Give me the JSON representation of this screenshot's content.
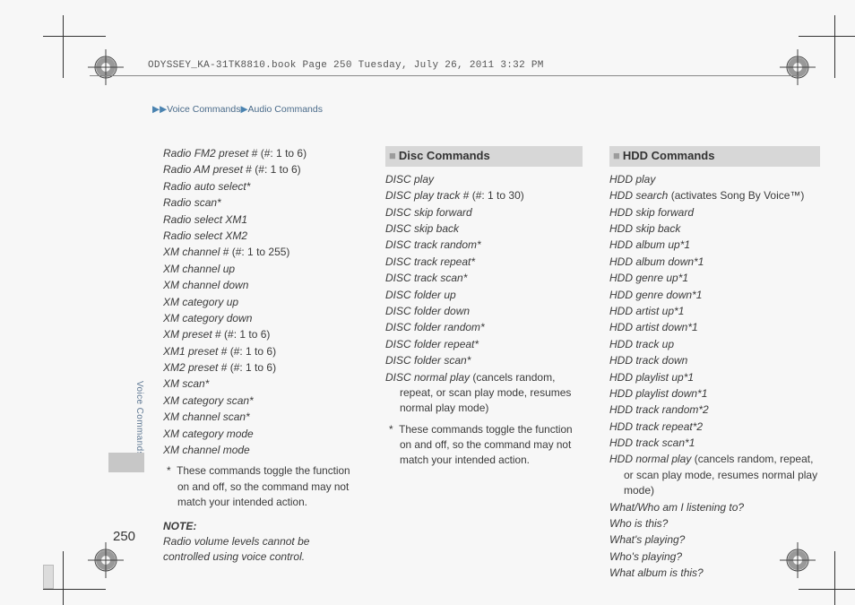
{
  "header_line": "ODYSSEY_KA-31TK8810.book  Page 250  Tuesday, July 26, 2011  3:32 PM",
  "breadcrumbs": {
    "a": "Voice Commands",
    "b": "Audio Commands"
  },
  "side_label": "Voice Commands",
  "page_number": "250",
  "col1": {
    "lines": [
      {
        "i": "Radio FM2 preset",
        "t": " # (#: 1 to 6)"
      },
      {
        "i": "Radio AM preset",
        "t": " # (#: 1 to 6)"
      },
      {
        "i": "Radio auto select*",
        "t": ""
      },
      {
        "i": "Radio scan*",
        "t": ""
      },
      {
        "i": "Radio select XM1",
        "t": ""
      },
      {
        "i": "Radio select XM2",
        "t": ""
      },
      {
        "i": "XM channel",
        "t": " # (#: 1 to 255)"
      },
      {
        "i": "XM channel up",
        "t": ""
      },
      {
        "i": "XM channel down",
        "t": ""
      },
      {
        "i": "XM category up",
        "t": ""
      },
      {
        "i": "XM category down",
        "t": ""
      },
      {
        "i": "XM preset",
        "t": " # (#: 1 to 6)"
      },
      {
        "i": "XM1 preset",
        "t": " # (#: 1 to 6)"
      },
      {
        "i": "XM2 preset",
        "t": " # (#: 1 to 6)"
      },
      {
        "i": "XM scan*",
        "t": ""
      },
      {
        "i": "XM category scan*",
        "t": ""
      },
      {
        "i": "XM channel scan*",
        "t": ""
      },
      {
        "i": "XM category mode",
        "t": ""
      },
      {
        "i": "XM channel mode",
        "t": ""
      }
    ],
    "star_note": "These commands toggle the function on and off, so the command may not match your intended action.",
    "note_head": "NOTE:",
    "note_body": "Radio volume levels cannot be controlled using voice control."
  },
  "col2": {
    "title": "Disc Commands",
    "lines": [
      {
        "i": "DISC play",
        "t": ""
      },
      {
        "i": "DISC play track",
        "t": " # (#: 1 to 30)"
      },
      {
        "i": "DISC skip forward",
        "t": ""
      },
      {
        "i": "DISC skip back",
        "t": ""
      },
      {
        "i": "DISC track random*",
        "t": ""
      },
      {
        "i": "DISC track repeat*",
        "t": ""
      },
      {
        "i": "DISC track scan*",
        "t": ""
      },
      {
        "i": "DISC folder up",
        "t": ""
      },
      {
        "i": "DISC folder down",
        "t": ""
      },
      {
        "i": "DISC folder random*",
        "t": ""
      },
      {
        "i": "DISC folder repeat*",
        "t": ""
      },
      {
        "i": "DISC folder scan*",
        "t": ""
      },
      {
        "i": "DISC normal play",
        "t": " (cancels random, repeat, or scan play mode, resumes normal play mode)"
      }
    ],
    "star_note": "These commands toggle the function on and off, so the command may not match your intended action."
  },
  "col3": {
    "title": "HDD Commands",
    "lines": [
      {
        "i": "HDD play",
        "t": ""
      },
      {
        "i": "HDD search",
        "t": " (activates Song By Voice™)"
      },
      {
        "i": "HDD skip forward",
        "t": ""
      },
      {
        "i": "HDD skip back",
        "t": ""
      },
      {
        "i": "HDD album up*1",
        "t": ""
      },
      {
        "i": "HDD album down*1",
        "t": ""
      },
      {
        "i": "HDD genre up*1",
        "t": ""
      },
      {
        "i": "HDD genre down*1",
        "t": ""
      },
      {
        "i": "HDD artist up*1",
        "t": ""
      },
      {
        "i": "HDD artist down*1",
        "t": ""
      },
      {
        "i": "HDD track up",
        "t": ""
      },
      {
        "i": "HDD track down",
        "t": ""
      },
      {
        "i": "HDD playlist up*1",
        "t": ""
      },
      {
        "i": "HDD playlist down*1",
        "t": ""
      },
      {
        "i": "HDD track random*2",
        "t": ""
      },
      {
        "i": "HDD track repeat*2",
        "t": ""
      },
      {
        "i": "HDD track scan*1",
        "t": ""
      },
      {
        "i": "HDD normal play",
        "t": " (cancels random, repeat, or scan play mode, resumes normal play mode)"
      },
      {
        "i": "What/Who am I listening to?",
        "t": ""
      },
      {
        "i": "Who is this?",
        "t": ""
      },
      {
        "i": "What's playing?",
        "t": ""
      },
      {
        "i": "Who's playing?",
        "t": ""
      },
      {
        "i": "What album is this?",
        "t": ""
      }
    ]
  }
}
